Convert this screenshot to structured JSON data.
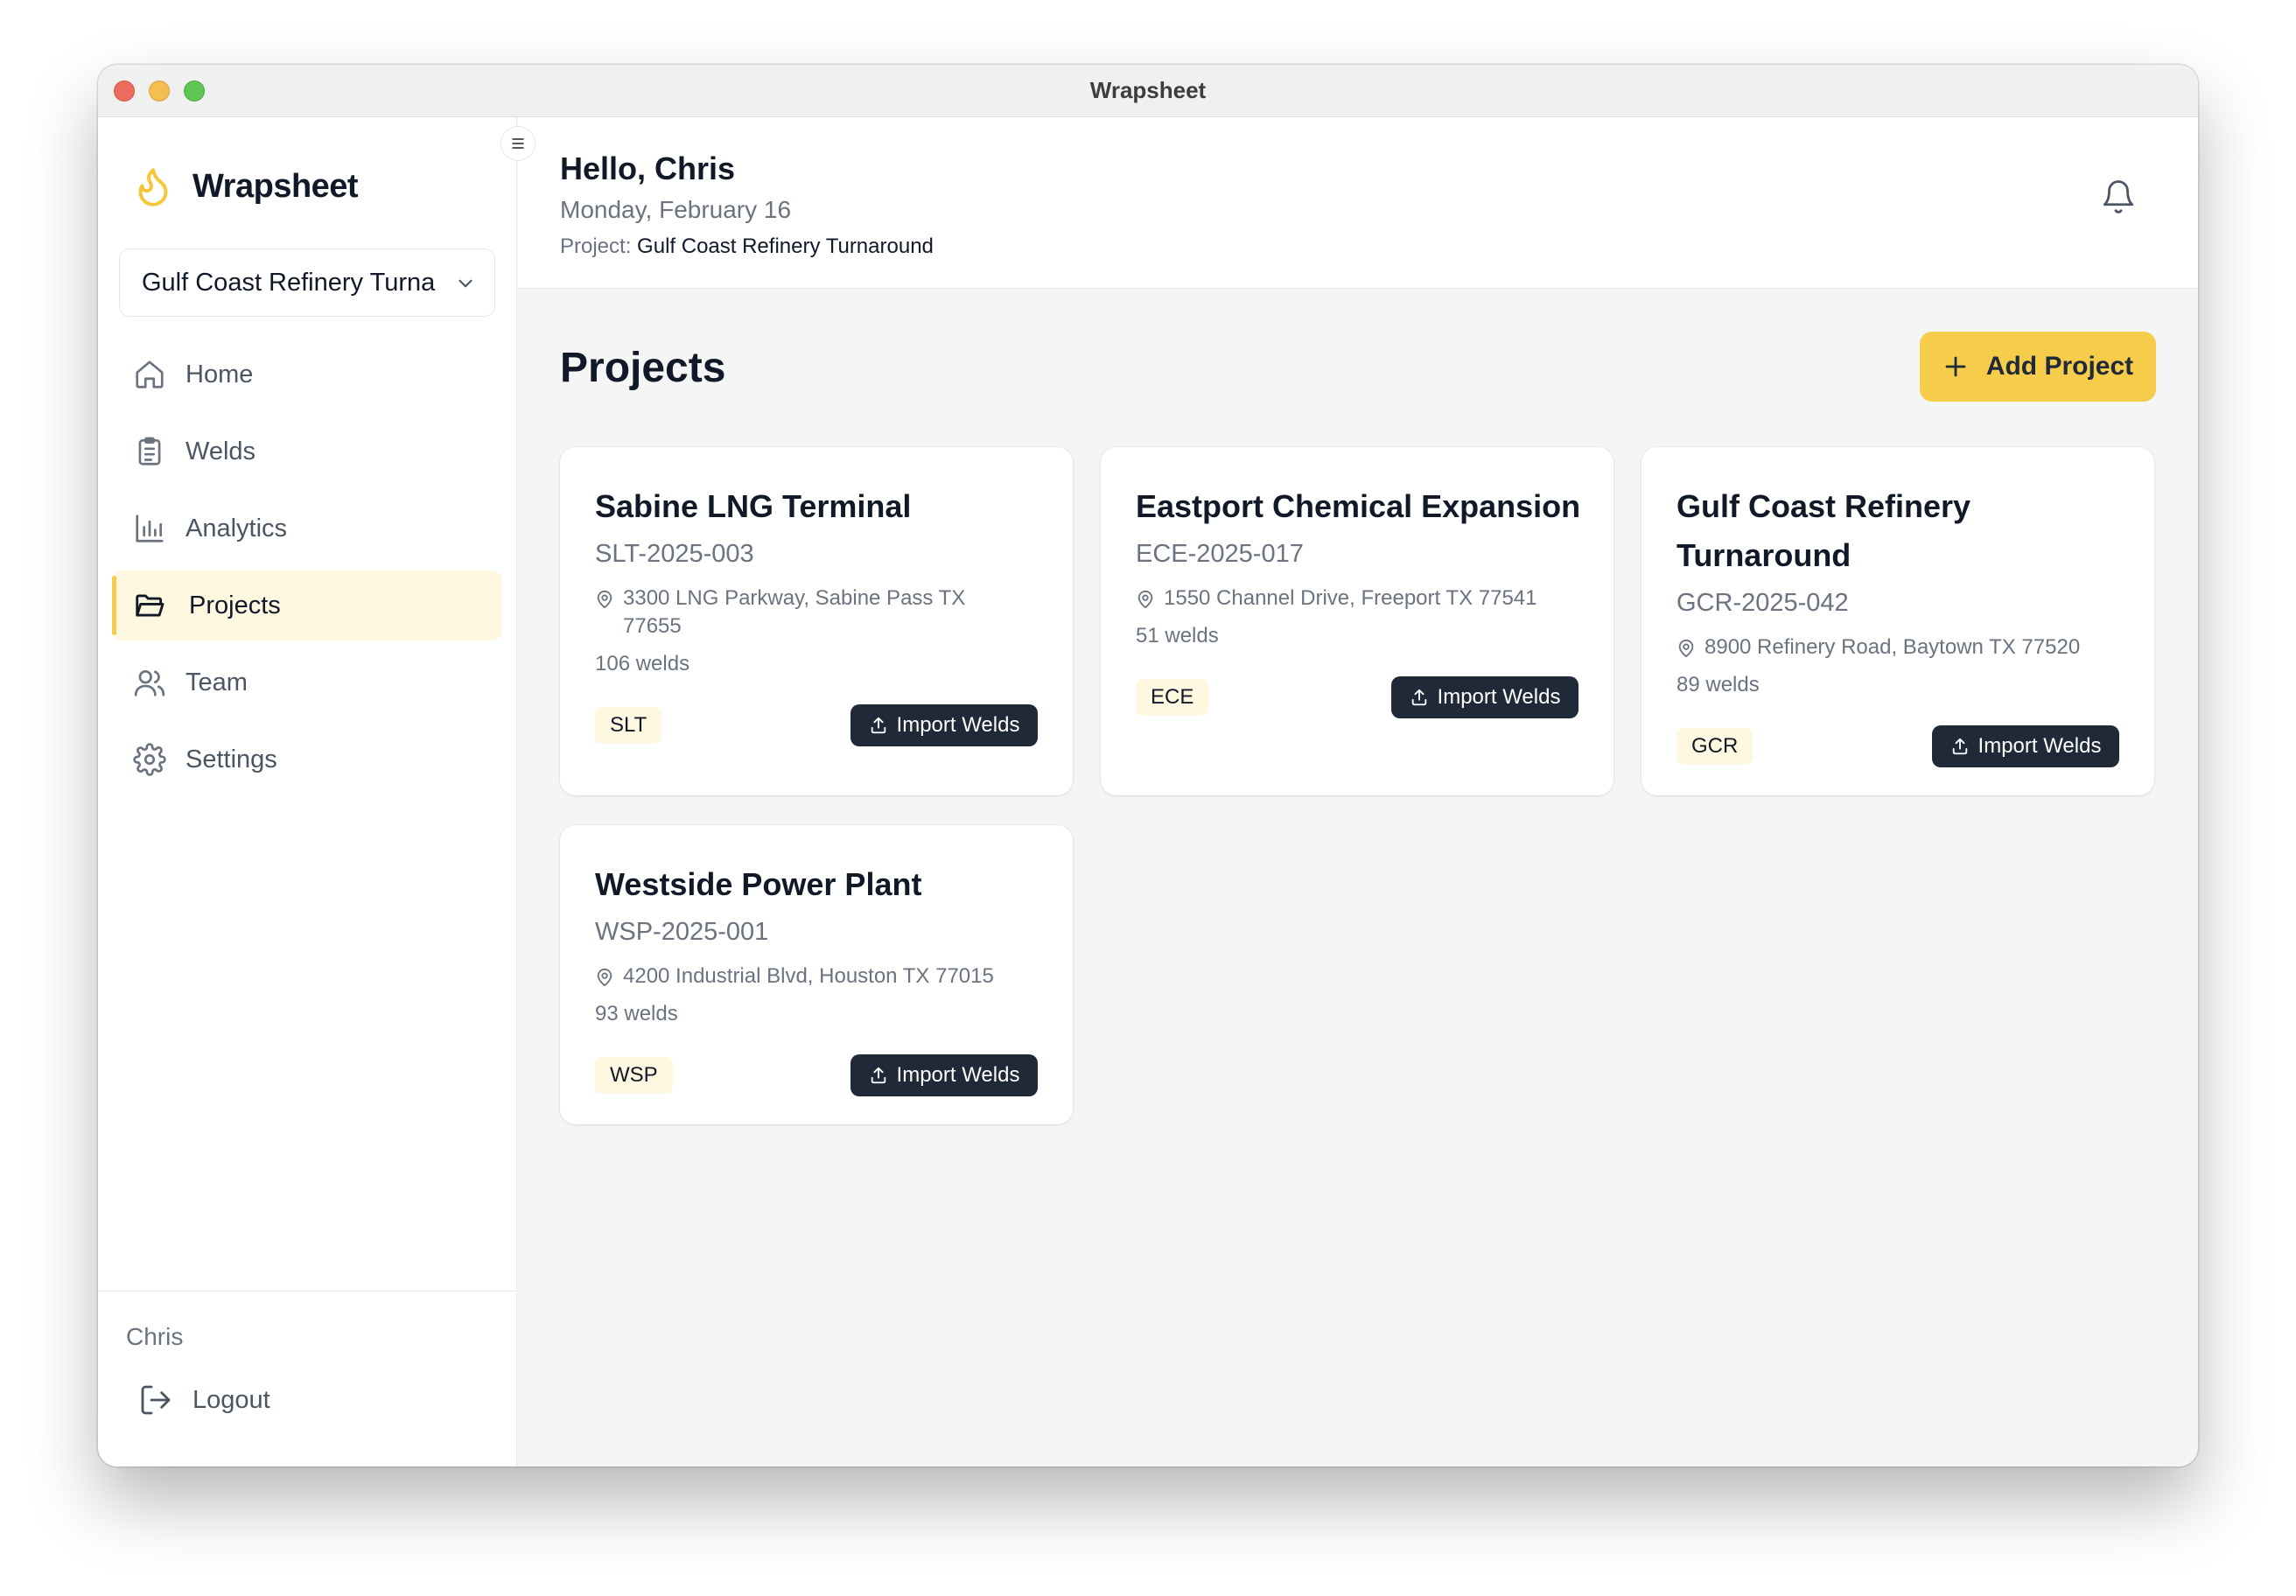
{
  "window": {
    "title": "Wrapsheet"
  },
  "sidebar": {
    "brand": "Wrapsheet",
    "project_select": {
      "value": "Gulf Coast Refinery Turna"
    },
    "items": [
      {
        "label": "Home",
        "icon": "home-icon"
      },
      {
        "label": "Welds",
        "icon": "clipboard-icon"
      },
      {
        "label": "Analytics",
        "icon": "bar-chart-icon"
      },
      {
        "label": "Projects",
        "icon": "folder-icon",
        "active": true
      },
      {
        "label": "Team",
        "icon": "users-icon"
      },
      {
        "label": "Settings",
        "icon": "gear-icon"
      }
    ],
    "user": "Chris",
    "logout": "Logout"
  },
  "header": {
    "greeting": "Hello, Chris",
    "date": "Monday, February 16",
    "project_label": "Project:",
    "project_value": "Gulf Coast Refinery Turnaround"
  },
  "main": {
    "title": "Projects",
    "add_button": "Add Project",
    "import_label": "Import Welds",
    "projects": [
      {
        "name": "Sabine LNG Terminal",
        "code": "SLT-2025-003",
        "address": "3300 LNG Parkway, Sabine Pass TX 77655",
        "welds": "106 welds",
        "tag": "SLT"
      },
      {
        "name": "Eastport Chemical Expansion",
        "code": "ECE-2025-017",
        "address": "1550 Channel Drive, Freeport TX 77541",
        "welds": "51 welds",
        "tag": "ECE"
      },
      {
        "name": "Gulf Coast Refinery Turnaround",
        "code": "GCR-2025-042",
        "address": "8900 Refinery Road, Baytown TX 77520",
        "welds": "89 welds",
        "tag": "GCR"
      },
      {
        "name": "Westside Power Plant",
        "code": "WSP-2025-001",
        "address": "4200 Industrial Blvd, Houston TX 77015",
        "welds": "93 welds",
        "tag": "WSP"
      }
    ]
  },
  "colors": {
    "accent": "#f6cd4a",
    "accent_light": "#fef8e0",
    "dark_button": "#1f2937"
  }
}
